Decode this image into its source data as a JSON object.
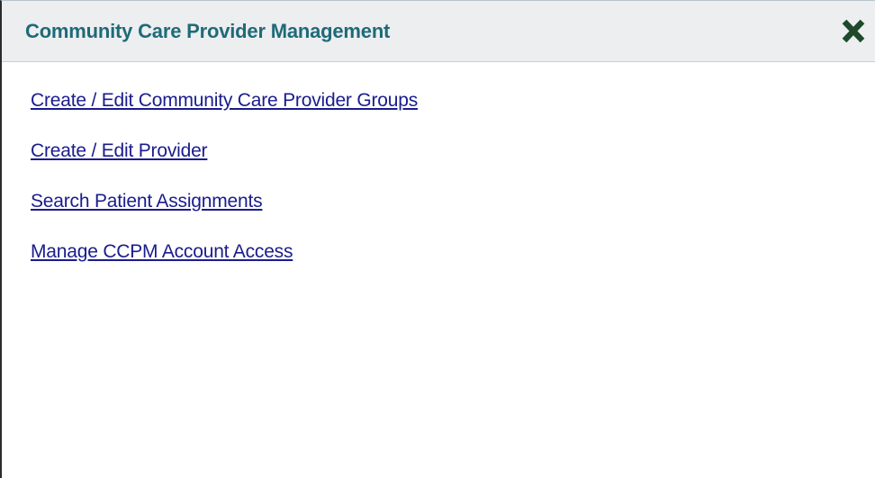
{
  "dialog": {
    "title": "Community Care Provider Management",
    "close_icon": "close-x-icon",
    "accent_color": "#1f6a78",
    "close_icon_color": "#1e4a2a"
  },
  "links": [
    {
      "label": "Create / Edit Community Care Provider Groups"
    },
    {
      "label": "Create / Edit Provider"
    },
    {
      "label": "Search Patient Assignments"
    },
    {
      "label": "Manage CCPM Account Access"
    }
  ]
}
